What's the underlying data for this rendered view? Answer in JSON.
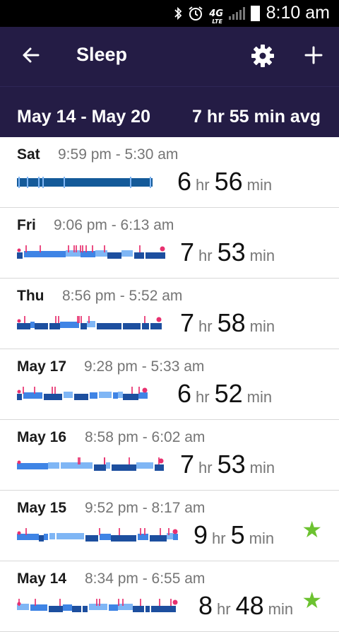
{
  "status": {
    "time": "8:10 am",
    "network": "4G",
    "network_sub": "LTE"
  },
  "appbar": {
    "title": "Sleep"
  },
  "week": {
    "range": "May 14 - May 20",
    "avg": "7 hr 55 min avg"
  },
  "entries": [
    {
      "day": "Sat",
      "range": "9:59 pm - 5:30 am",
      "hours": "6",
      "hr_unit": "hr",
      "minutes": "56",
      "min_unit": "min",
      "star": false,
      "style": "classic",
      "width_frac": 0.79
    },
    {
      "day": "Fri",
      "range": "9:06 pm - 6:13 am",
      "hours": "7",
      "hr_unit": "hr",
      "minutes": "53",
      "min_unit": "min",
      "star": false,
      "style": "stages",
      "width_frac": 0.86
    },
    {
      "day": "Thu",
      "range": "8:56 pm - 5:52 am",
      "hours": "7",
      "hr_unit": "hr",
      "minutes": "58",
      "min_unit": "min",
      "star": false,
      "style": "stages",
      "width_frac": 0.84
    },
    {
      "day": "May 17",
      "range": "9:28 pm - 5:33 am",
      "hours": "6",
      "hr_unit": "hr",
      "minutes": "52",
      "min_unit": "min",
      "star": false,
      "style": "stages",
      "width_frac": 0.76
    },
    {
      "day": "May 16",
      "range": "8:58 pm - 6:02 am",
      "hours": "7",
      "hr_unit": "hr",
      "minutes": "53",
      "min_unit": "min",
      "star": false,
      "style": "stages",
      "width_frac": 0.85
    },
    {
      "day": "May 15",
      "range": "9:52 pm - 8:17 am",
      "hours": "9",
      "hr_unit": "hr",
      "minutes": "5",
      "min_unit": "min",
      "star": true,
      "style": "stages",
      "width_frac": 0.98
    },
    {
      "day": "May 14",
      "range": "8:34 pm - 6:55 am",
      "hours": "8",
      "hr_unit": "hr",
      "minutes": "48",
      "min_unit": "min",
      "star": true,
      "style": "stages",
      "width_frac": 0.97
    }
  ],
  "colors": {
    "header": "#241c45",
    "deep": "#1d4f9f",
    "light": "#3f84e5",
    "rem": "#7fb6f5",
    "awake": "#e8306f",
    "classic": "#145a99",
    "star": "#6cc230"
  },
  "icons": {
    "back": "arrow-left-icon",
    "settings": "gear-icon",
    "add": "plus-icon",
    "star": "star-icon"
  }
}
